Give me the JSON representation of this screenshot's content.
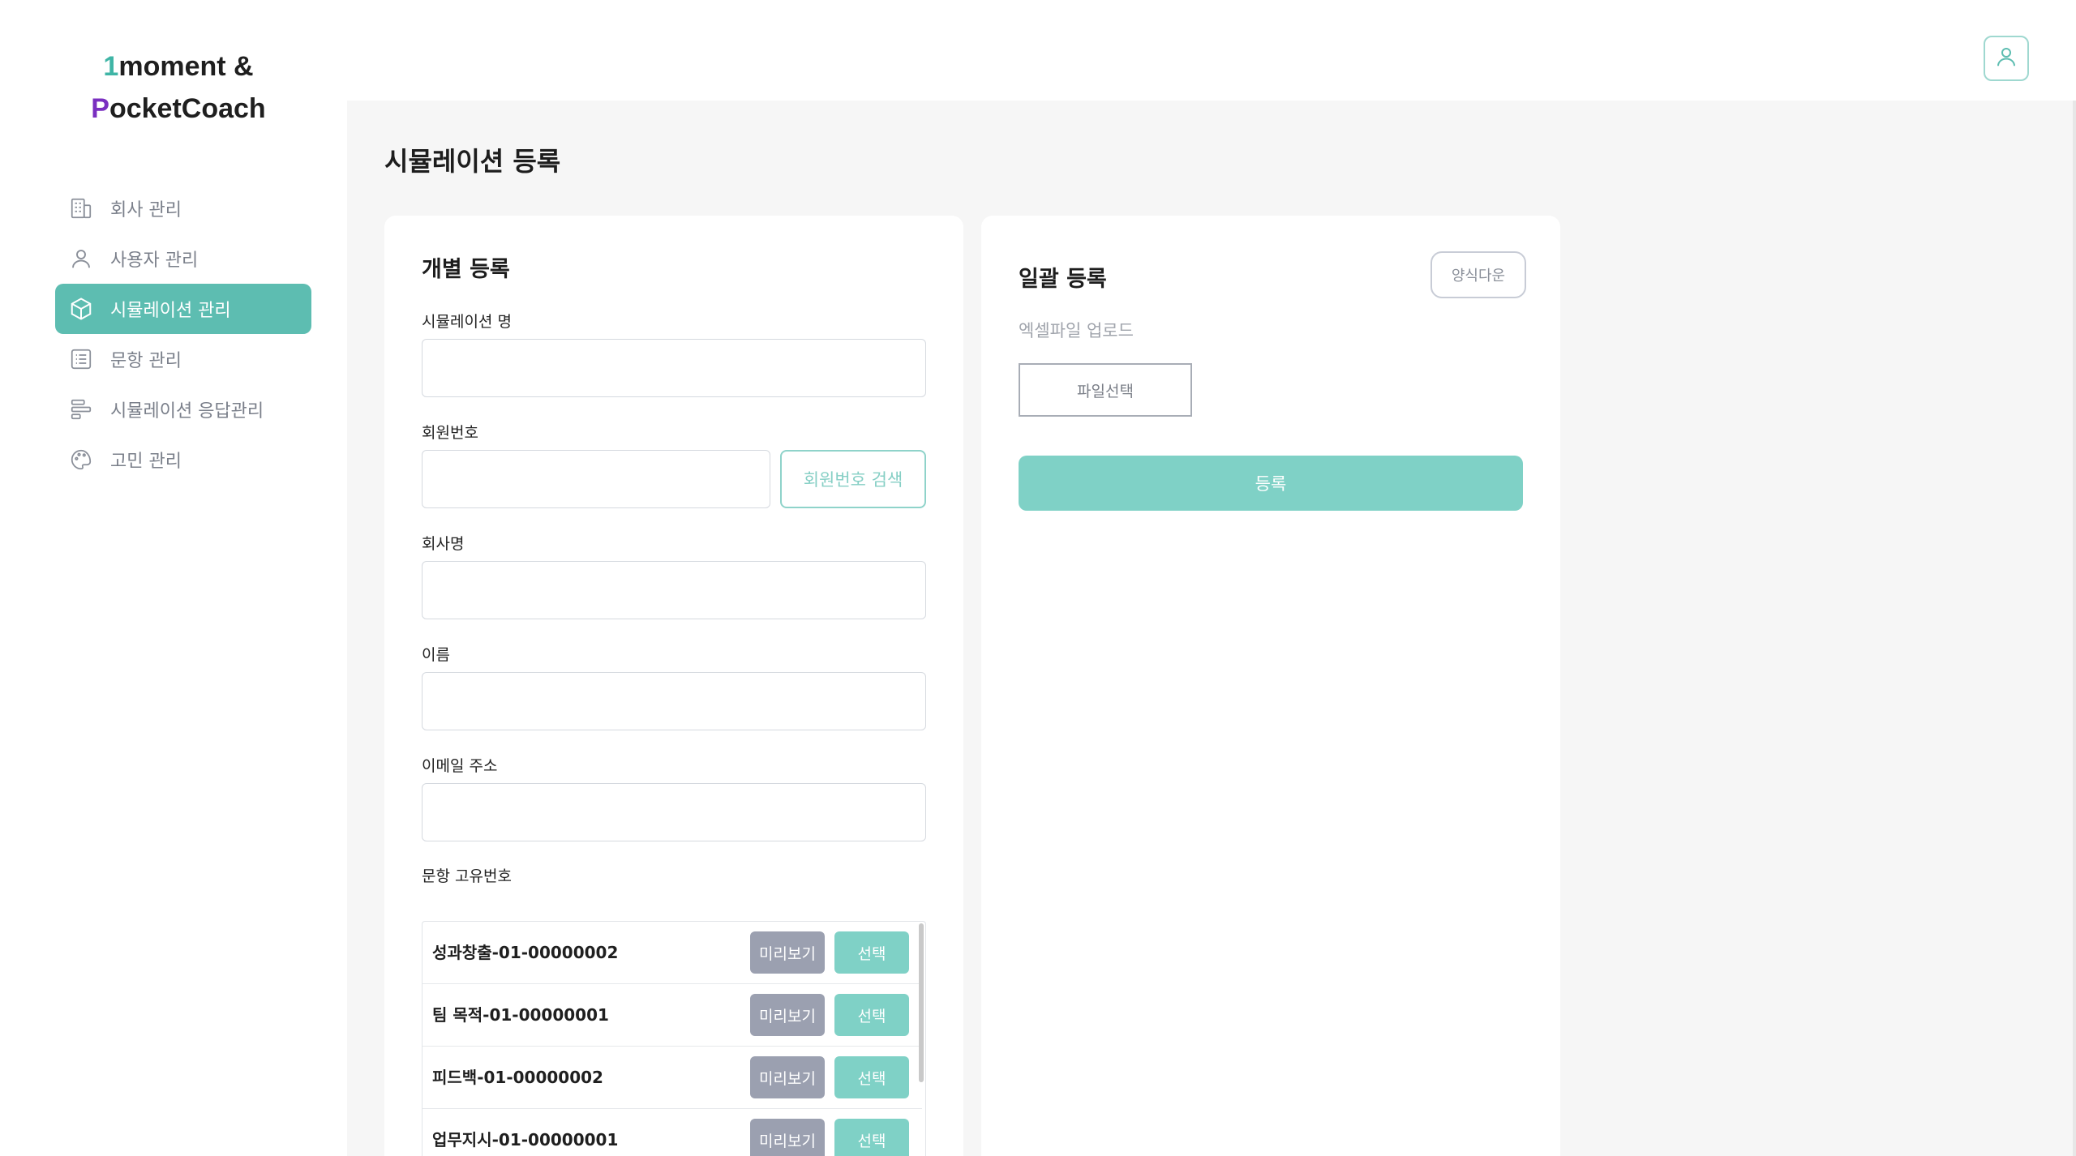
{
  "logo": {
    "first_char": "1",
    "line1_rest": "moment &",
    "second_char": "P",
    "line2_rest": "ocketCoach"
  },
  "sidebar": {
    "items": [
      {
        "label": "회사 관리",
        "icon": "building-icon"
      },
      {
        "label": "사용자 관리",
        "icon": "user-icon"
      },
      {
        "label": "시뮬레이션 관리",
        "icon": "cube-icon",
        "active": true
      },
      {
        "label": "문항 관리",
        "icon": "list-icon"
      },
      {
        "label": "시뮬레이션 응답관리",
        "icon": "bars-icon"
      },
      {
        "label": "고민 관리",
        "icon": "palette-icon"
      }
    ]
  },
  "header": {
    "profile_icon": "user-icon"
  },
  "page": {
    "title": "시뮬레이션 등록"
  },
  "individual": {
    "title": "개별 등록",
    "fields": {
      "simulation_name": {
        "label": "시뮬레이션 명",
        "value": ""
      },
      "member_no": {
        "label": "회원번호",
        "value": ""
      },
      "company": {
        "label": "회사명",
        "value": ""
      },
      "name": {
        "label": "이름",
        "value": ""
      },
      "email": {
        "label": "이메일 주소",
        "value": ""
      }
    },
    "member_search_label": "회원번호 검색",
    "question_id_label": "문항 고유번호",
    "questions": [
      {
        "code": "성과창출-01-00000002"
      },
      {
        "code": "팀 목적-01-00000001"
      },
      {
        "code": "피드백-01-00000002"
      },
      {
        "code": "업무지시-01-00000001"
      }
    ],
    "preview_label": "미리보기",
    "select_label": "선택"
  },
  "bulk": {
    "title": "일괄 등록",
    "download_label": "양식다운",
    "excel_label": "엑셀파일 업로드",
    "file_select_label": "파일선택",
    "submit_label": "등록"
  },
  "colors": {
    "accent": "#5dbdb1",
    "accent_light": "#7fd1c6",
    "preview_gray": "#9ba0b0",
    "logo_teal": "#3fb5a6",
    "logo_purple": "#7a2fc0"
  }
}
